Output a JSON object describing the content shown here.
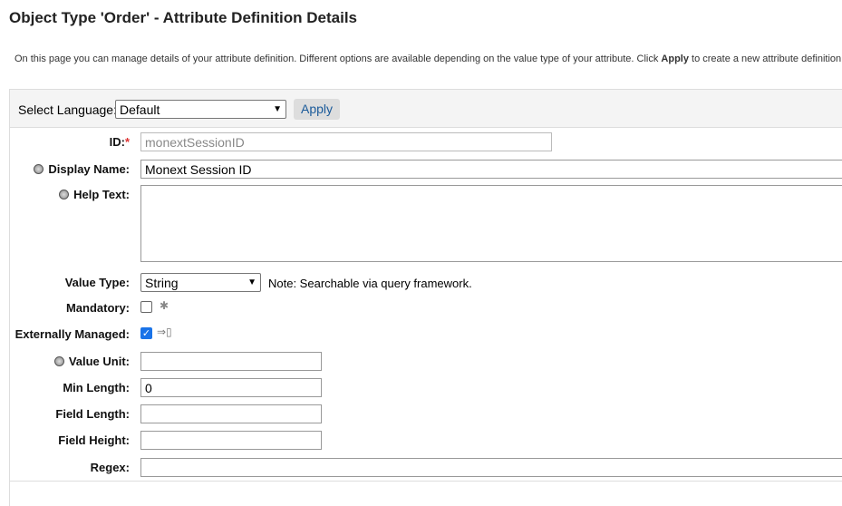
{
  "page": {
    "title": "Object Type 'Order' - Attribute Definition Details",
    "description_pre": "On this page you can manage details of your attribute definition. Different options are available depending on the value type of your attribute. Click ",
    "description_bold": "Apply",
    "description_post": " to create a new attribute definition"
  },
  "language": {
    "label": "Select Language:",
    "value": "Default",
    "apply": "Apply"
  },
  "form": {
    "id": {
      "label": "ID:",
      "required": "*",
      "value": "monextSessionID"
    },
    "display_name": {
      "label": "Display Name:",
      "value": "Monext Session ID"
    },
    "help_text": {
      "label": "Help Text:",
      "value": ""
    },
    "value_type": {
      "label": "Value Type:",
      "value": "String",
      "note": "Note: Searchable via query framework."
    },
    "mandatory": {
      "label": "Mandatory:",
      "checked": false
    },
    "externally_managed": {
      "label": "Externally Managed:",
      "checked": true
    },
    "value_unit": {
      "label": "Value Unit:",
      "value": ""
    },
    "min_length": {
      "label": "Min Length:",
      "value": "0"
    },
    "field_length": {
      "label": "Field Length:",
      "value": ""
    },
    "field_height": {
      "label": "Field Height:",
      "value": ""
    },
    "regex": {
      "label": "Regex:",
      "value": ""
    }
  }
}
